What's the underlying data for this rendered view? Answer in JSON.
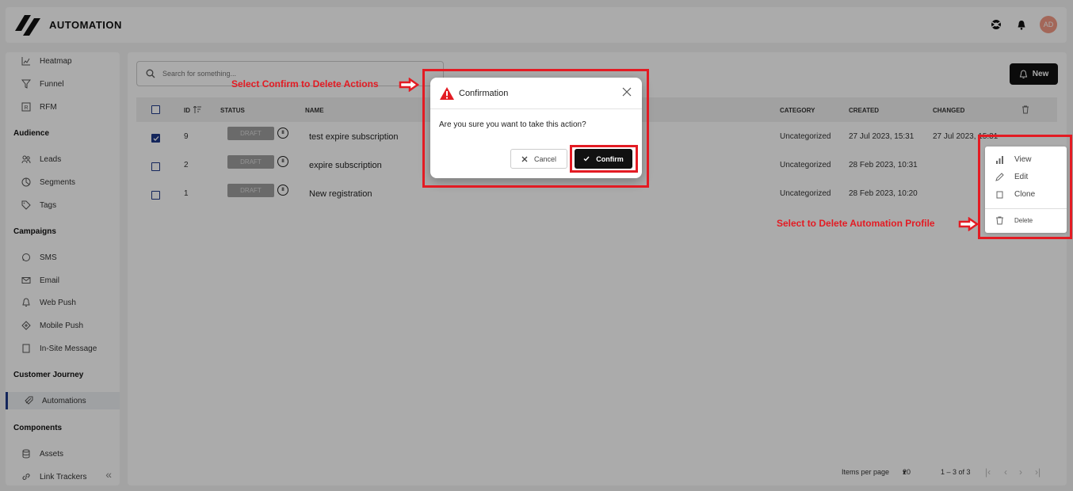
{
  "app": {
    "title": "AUTOMATION",
    "avatar_initials": "AD"
  },
  "sidebar": {
    "items_top": [
      {
        "label": "Heatmap",
        "icon": "heatmap-icon"
      },
      {
        "label": "Funnel",
        "icon": "funnel-icon"
      },
      {
        "label": "RFM",
        "icon": "rfm-icon"
      }
    ],
    "sections": {
      "audience": "Audience",
      "campaigns": "Campaigns",
      "customer_journey": "Customer Journey",
      "components": "Components"
    },
    "audience_items": [
      {
        "label": "Leads"
      },
      {
        "label": "Segments"
      },
      {
        "label": "Tags"
      }
    ],
    "campaign_items": [
      {
        "label": "SMS"
      },
      {
        "label": "Email"
      },
      {
        "label": "Web Push"
      },
      {
        "label": "Mobile Push"
      },
      {
        "label": "In-Site Message"
      }
    ],
    "journey_items": [
      {
        "label": "Automations"
      }
    ],
    "component_items": [
      {
        "label": "Assets"
      },
      {
        "label": "Link Trackers"
      }
    ]
  },
  "search": {
    "placeholder": "Search for something..."
  },
  "toolbar": {
    "new_label": "New"
  },
  "table": {
    "headers": {
      "id": "ID",
      "status": "STATUS",
      "name": "NAME",
      "category": "CATEGORY",
      "created": "CREATED",
      "changed": "CHANGED"
    },
    "rows": [
      {
        "id": "9",
        "status": "DRAFT",
        "name": "test expire subscription",
        "category": "Uncategorized",
        "created": "27 Jul 2023, 15:31",
        "changed": "27 Jul 2023, 15:31",
        "checked": true
      },
      {
        "id": "2",
        "status": "DRAFT",
        "name": "expire subscription",
        "category": "Uncategorized",
        "created": "28 Feb 2023, 10:31",
        "changed": "",
        "checked": false
      },
      {
        "id": "1",
        "status": "DRAFT",
        "name": "New registration",
        "category": "Uncategorized",
        "created": "28 Feb 2023, 10:20",
        "changed": "",
        "checked": false
      }
    ]
  },
  "pagination": {
    "items_per_page_label": "Items per page",
    "items_per_page": "20",
    "range": "1 – 3 of 3"
  },
  "context_menu": {
    "view": "View",
    "edit": "Edit",
    "clone": "Clone",
    "delete": "Delete"
  },
  "modal": {
    "title": "Confirmation",
    "message": "Are you sure you want to take this action?",
    "cancel_label": "Cancel",
    "confirm_label": "Confirm"
  },
  "annotations": {
    "confirm_note": "Select Confirm to Delete Actions",
    "delete_note": "Select to Delete Automation Profile"
  },
  "colors": {
    "accent": "#1f3a8a",
    "highlight": "#e31b23",
    "avatar": "#f39a85",
    "draft": "#9e9e9e"
  }
}
